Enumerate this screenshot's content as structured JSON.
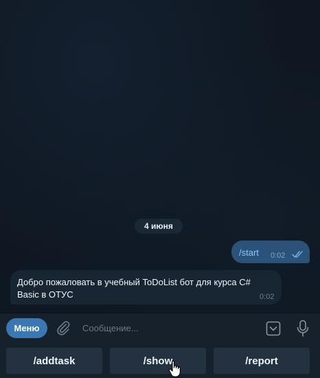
{
  "chat": {
    "date_label": "4 июня",
    "outgoing": {
      "text": "/start",
      "time": "0:02",
      "status": "read"
    },
    "incoming": {
      "text": "Добро пожаловать в учебный ToDoList бот для курса C# Basic в ОТУС",
      "time": "0:02"
    }
  },
  "composer": {
    "menu_label": "Меню",
    "placeholder": "Сообщение..."
  },
  "keyboard": {
    "buttons": [
      "/addtask",
      "/show",
      "/report"
    ]
  },
  "colors": {
    "background": "#0e1621",
    "outgoing_bubble": "#2b5278",
    "incoming_bubble": "#182533",
    "menu_button": "#3a78b4",
    "keyboard_button": "#233140"
  },
  "icons": [
    "paperclip-icon",
    "keyboard-toggle-icon",
    "microphone-icon",
    "double-check-icon",
    "hand-cursor-icon"
  ]
}
